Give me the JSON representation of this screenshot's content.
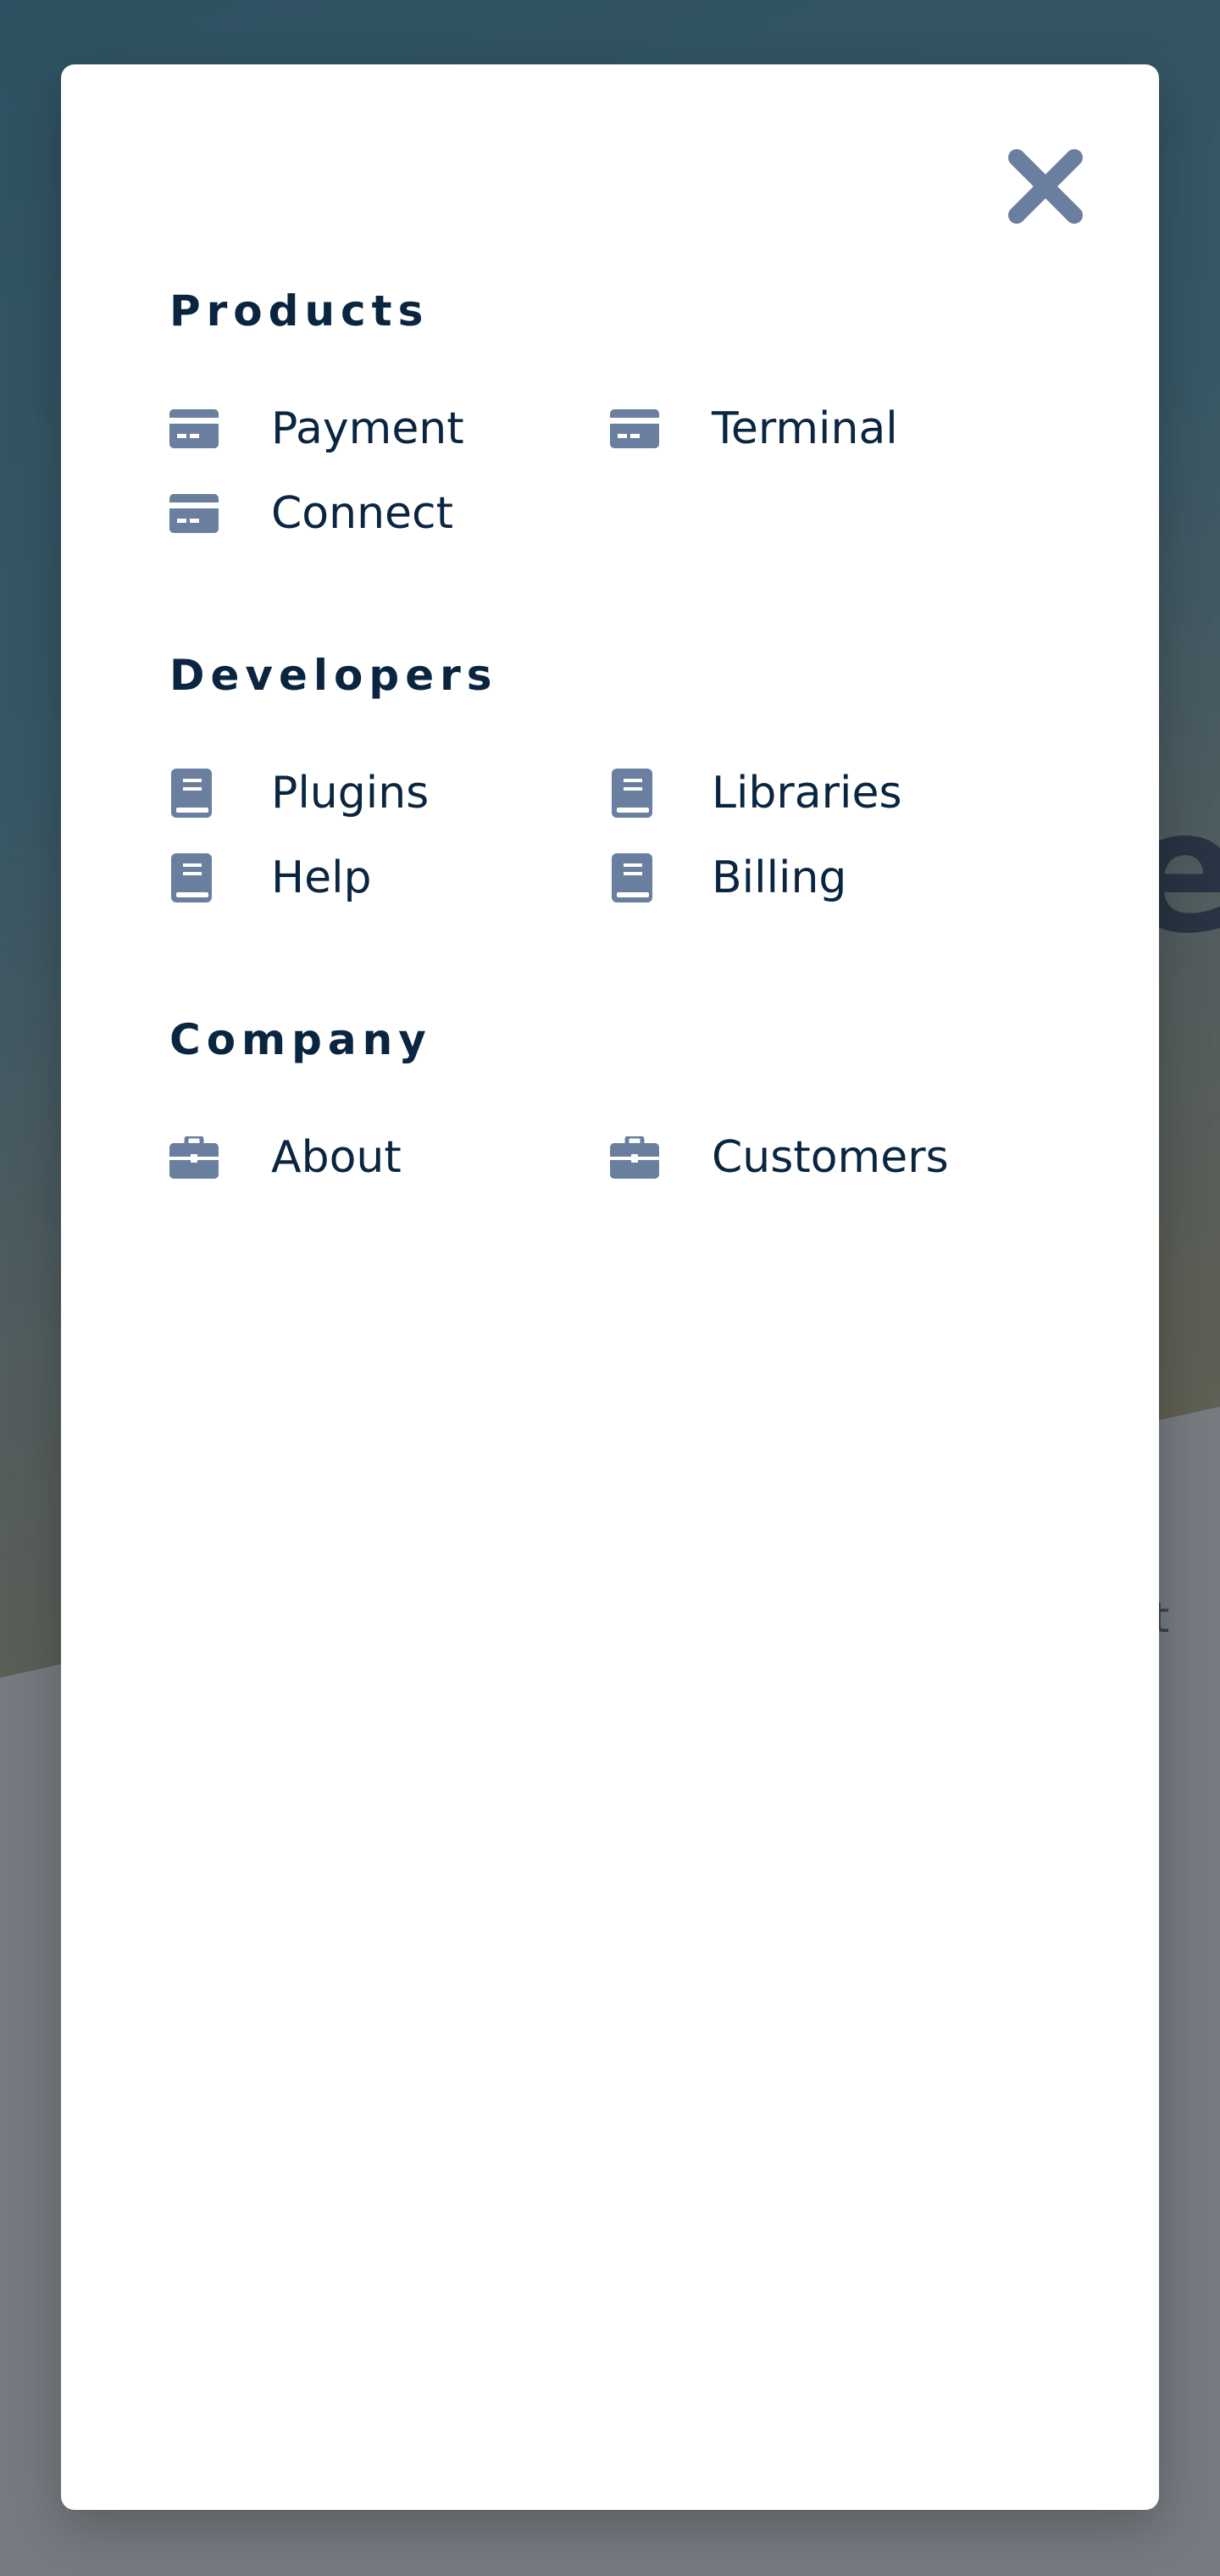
{
  "background": {
    "partial_text_right": "ot",
    "partial_glyph_right": "e"
  },
  "menu": {
    "sections": [
      {
        "title": "Products",
        "icon": "credit-card-icon",
        "links": [
          {
            "label": "Payment"
          },
          {
            "label": "Terminal"
          },
          {
            "label": "Connect"
          }
        ]
      },
      {
        "title": "Developers",
        "icon": "book-icon",
        "links": [
          {
            "label": "Plugins"
          },
          {
            "label": "Libraries"
          },
          {
            "label": "Help"
          },
          {
            "label": "Billing"
          }
        ]
      },
      {
        "title": "Company",
        "icon": "briefcase-icon",
        "links": [
          {
            "label": "About"
          },
          {
            "label": "Customers"
          }
        ]
      }
    ]
  },
  "colors": {
    "heading": "#0a2540",
    "icon": "#6a7fa0",
    "panel": "#ffffff"
  }
}
